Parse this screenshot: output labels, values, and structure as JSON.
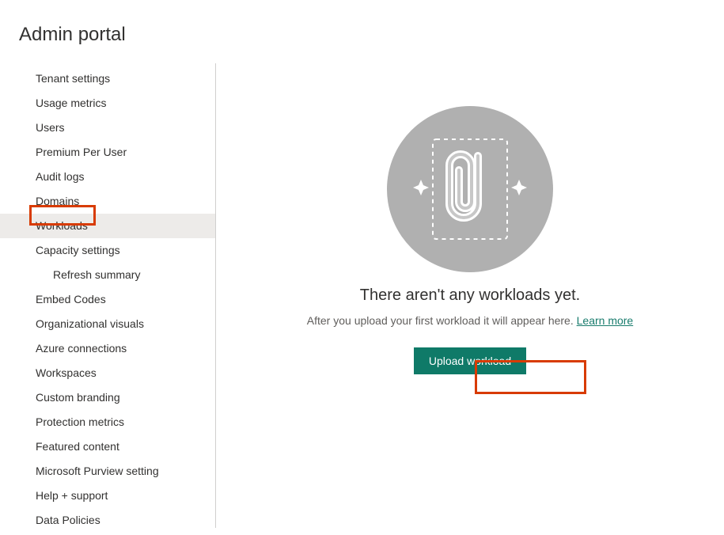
{
  "header": {
    "title": "Admin portal"
  },
  "sidebar": {
    "items": [
      {
        "label": "Tenant settings",
        "selected": false,
        "sub": false
      },
      {
        "label": "Usage metrics",
        "selected": false,
        "sub": false
      },
      {
        "label": "Users",
        "selected": false,
        "sub": false
      },
      {
        "label": "Premium Per User",
        "selected": false,
        "sub": false
      },
      {
        "label": "Audit logs",
        "selected": false,
        "sub": false
      },
      {
        "label": "Domains",
        "selected": false,
        "sub": false
      },
      {
        "label": "Workloads",
        "selected": true,
        "sub": false
      },
      {
        "label": "Capacity settings",
        "selected": false,
        "sub": false
      },
      {
        "label": "Refresh summary",
        "selected": false,
        "sub": true
      },
      {
        "label": "Embed Codes",
        "selected": false,
        "sub": false
      },
      {
        "label": "Organizational visuals",
        "selected": false,
        "sub": false
      },
      {
        "label": "Azure connections",
        "selected": false,
        "sub": false
      },
      {
        "label": "Workspaces",
        "selected": false,
        "sub": false
      },
      {
        "label": "Custom branding",
        "selected": false,
        "sub": false
      },
      {
        "label": "Protection metrics",
        "selected": false,
        "sub": false
      },
      {
        "label": "Featured content",
        "selected": false,
        "sub": false
      },
      {
        "label": "Microsoft Purview setting",
        "selected": false,
        "sub": false
      },
      {
        "label": "Help + support",
        "selected": false,
        "sub": false
      },
      {
        "label": "Data Policies",
        "selected": false,
        "sub": false
      }
    ]
  },
  "empty_state": {
    "title": "There aren't any workloads yet.",
    "subtitle_prefix": "After you upload your first workload it will appear here. ",
    "learn_more_label": "Learn more",
    "upload_label": "Upload workload"
  }
}
